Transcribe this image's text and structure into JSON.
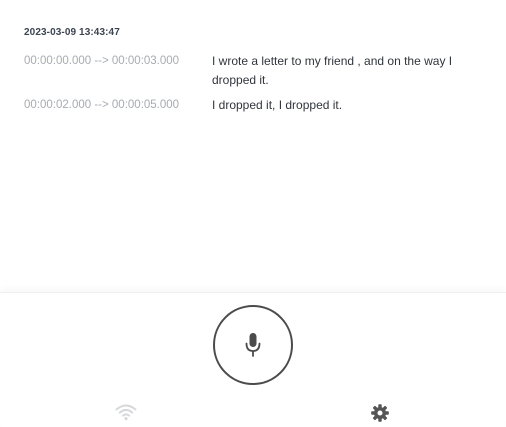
{
  "session": {
    "date": "2023-03-09 13:43:47"
  },
  "segments": [
    {
      "time": "00:00:00.000 --> 00:00:03.000",
      "text": "I wrote a letter to my friend , and on the way I dropped it."
    },
    {
      "time": "00:00:02.000 --> 00:00:05.000",
      "text": "I dropped it, I dropped it."
    }
  ],
  "controls": {
    "mic_icon": "microphone-icon",
    "connection_icon": "wifi-icon",
    "settings_icon": "gear-icon"
  },
  "colors": {
    "mic_border": "#4b4b4b",
    "wifi_inactive": "#d6d8db",
    "gear": "#555555",
    "timestamp": "#a7abb1",
    "text": "#30353c"
  }
}
